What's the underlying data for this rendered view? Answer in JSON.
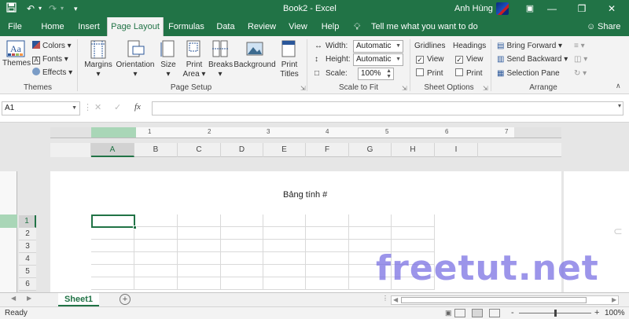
{
  "title_bar": {
    "doc_title": "Book2  -  Excel",
    "user_name": "Anh Hùng",
    "save_icon": "save-icon",
    "undo_icon": "undo-icon",
    "redo_icon": "redo-icon",
    "minimize": "—",
    "restore": "❒",
    "close": "✕"
  },
  "tabs": [
    {
      "label": "File"
    },
    {
      "label": "Home"
    },
    {
      "label": "Insert"
    },
    {
      "label": "Page Layout"
    },
    {
      "label": "Formulas"
    },
    {
      "label": "Data"
    },
    {
      "label": "Review"
    },
    {
      "label": "View"
    },
    {
      "label": "Help"
    }
  ],
  "tell_me": "Tell me what you want to do",
  "share": "Share",
  "ribbon": {
    "themes": {
      "label": "Themes",
      "colors": "Colors",
      "fonts": "Fonts",
      "effects": "Effects",
      "group": "Themes"
    },
    "page_setup": {
      "margins": "Margins",
      "orientation": "Orientation",
      "size": "Size",
      "print_area_1": "Print",
      "print_area_2": "Area",
      "breaks": "Breaks",
      "background": "Background",
      "print_titles_1": "Print",
      "print_titles_2": "Titles",
      "group": "Page Setup"
    },
    "scale_to_fit": {
      "width_label": "Width:",
      "width_value": "Automatic",
      "height_label": "Height:",
      "height_value": "Automatic",
      "scale_label": "Scale:",
      "scale_value": "100%",
      "group": "Scale to Fit"
    },
    "sheet_options": {
      "gridlines": "Gridlines",
      "headings": "Headings",
      "view": "View",
      "print": "Print",
      "group": "Sheet Options"
    },
    "arrange": {
      "bring_forward": "Bring Forward",
      "send_backward": "Send Backward",
      "selection_pane": "Selection Pane",
      "group": "Arrange"
    }
  },
  "formula_bar": {
    "name_box": "A1",
    "cancel": "✕",
    "enter": "✓",
    "fx": "fx",
    "value": ""
  },
  "ruler_numbers": [
    "1",
    "2",
    "3",
    "4",
    "5",
    "6",
    "7"
  ],
  "columns": [
    "A",
    "B",
    "C",
    "D",
    "E",
    "F",
    "G",
    "H",
    "I"
  ],
  "rows": [
    "1",
    "2",
    "3",
    "4",
    "5",
    "6"
  ],
  "sheet_header_text": "Bảng tính #",
  "watermark": "freetut.net",
  "sheet_tabs": [
    {
      "label": "Sheet1"
    }
  ],
  "add_sheet": "+",
  "status": {
    "ready": "Ready",
    "zoom": "100%",
    "zoom_minus": "-",
    "zoom_plus": "+"
  }
}
